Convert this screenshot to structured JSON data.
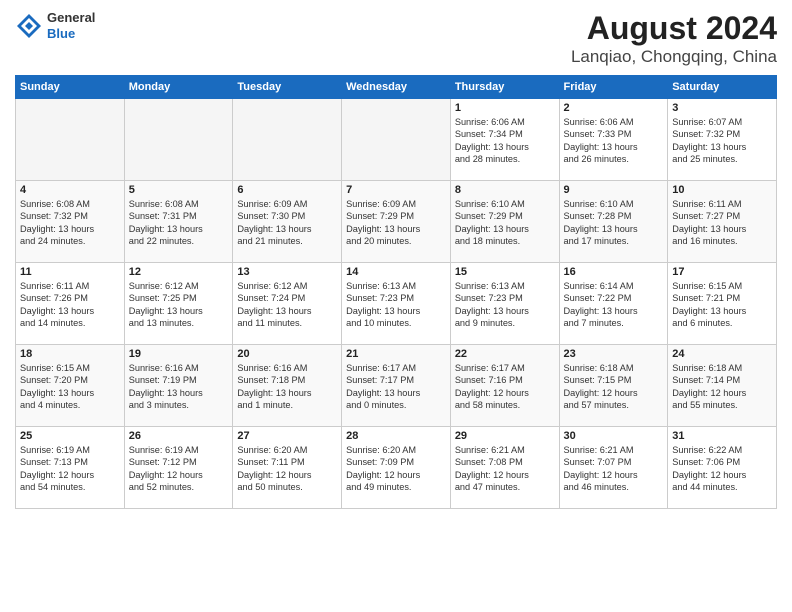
{
  "header": {
    "logo_general": "General",
    "logo_blue": "Blue",
    "title": "August 2024",
    "subtitle": "Lanqiao, Chongqing, China"
  },
  "weekdays": [
    "Sunday",
    "Monday",
    "Tuesday",
    "Wednesday",
    "Thursday",
    "Friday",
    "Saturday"
  ],
  "weeks": [
    [
      {
        "day": "",
        "info": ""
      },
      {
        "day": "",
        "info": ""
      },
      {
        "day": "",
        "info": ""
      },
      {
        "day": "",
        "info": ""
      },
      {
        "day": "1",
        "info": "Sunrise: 6:06 AM\nSunset: 7:34 PM\nDaylight: 13 hours\nand 28 minutes."
      },
      {
        "day": "2",
        "info": "Sunrise: 6:06 AM\nSunset: 7:33 PM\nDaylight: 13 hours\nand 26 minutes."
      },
      {
        "day": "3",
        "info": "Sunrise: 6:07 AM\nSunset: 7:32 PM\nDaylight: 13 hours\nand 25 minutes."
      }
    ],
    [
      {
        "day": "4",
        "info": "Sunrise: 6:08 AM\nSunset: 7:32 PM\nDaylight: 13 hours\nand 24 minutes."
      },
      {
        "day": "5",
        "info": "Sunrise: 6:08 AM\nSunset: 7:31 PM\nDaylight: 13 hours\nand 22 minutes."
      },
      {
        "day": "6",
        "info": "Sunrise: 6:09 AM\nSunset: 7:30 PM\nDaylight: 13 hours\nand 21 minutes."
      },
      {
        "day": "7",
        "info": "Sunrise: 6:09 AM\nSunset: 7:29 PM\nDaylight: 13 hours\nand 20 minutes."
      },
      {
        "day": "8",
        "info": "Sunrise: 6:10 AM\nSunset: 7:29 PM\nDaylight: 13 hours\nand 18 minutes."
      },
      {
        "day": "9",
        "info": "Sunrise: 6:10 AM\nSunset: 7:28 PM\nDaylight: 13 hours\nand 17 minutes."
      },
      {
        "day": "10",
        "info": "Sunrise: 6:11 AM\nSunset: 7:27 PM\nDaylight: 13 hours\nand 16 minutes."
      }
    ],
    [
      {
        "day": "11",
        "info": "Sunrise: 6:11 AM\nSunset: 7:26 PM\nDaylight: 13 hours\nand 14 minutes."
      },
      {
        "day": "12",
        "info": "Sunrise: 6:12 AM\nSunset: 7:25 PM\nDaylight: 13 hours\nand 13 minutes."
      },
      {
        "day": "13",
        "info": "Sunrise: 6:12 AM\nSunset: 7:24 PM\nDaylight: 13 hours\nand 11 minutes."
      },
      {
        "day": "14",
        "info": "Sunrise: 6:13 AM\nSunset: 7:23 PM\nDaylight: 13 hours\nand 10 minutes."
      },
      {
        "day": "15",
        "info": "Sunrise: 6:13 AM\nSunset: 7:23 PM\nDaylight: 13 hours\nand 9 minutes."
      },
      {
        "day": "16",
        "info": "Sunrise: 6:14 AM\nSunset: 7:22 PM\nDaylight: 13 hours\nand 7 minutes."
      },
      {
        "day": "17",
        "info": "Sunrise: 6:15 AM\nSunset: 7:21 PM\nDaylight: 13 hours\nand 6 minutes."
      }
    ],
    [
      {
        "day": "18",
        "info": "Sunrise: 6:15 AM\nSunset: 7:20 PM\nDaylight: 13 hours\nand 4 minutes."
      },
      {
        "day": "19",
        "info": "Sunrise: 6:16 AM\nSunset: 7:19 PM\nDaylight: 13 hours\nand 3 minutes."
      },
      {
        "day": "20",
        "info": "Sunrise: 6:16 AM\nSunset: 7:18 PM\nDaylight: 13 hours\nand 1 minute."
      },
      {
        "day": "21",
        "info": "Sunrise: 6:17 AM\nSunset: 7:17 PM\nDaylight: 13 hours\nand 0 minutes."
      },
      {
        "day": "22",
        "info": "Sunrise: 6:17 AM\nSunset: 7:16 PM\nDaylight: 12 hours\nand 58 minutes."
      },
      {
        "day": "23",
        "info": "Sunrise: 6:18 AM\nSunset: 7:15 PM\nDaylight: 12 hours\nand 57 minutes."
      },
      {
        "day": "24",
        "info": "Sunrise: 6:18 AM\nSunset: 7:14 PM\nDaylight: 12 hours\nand 55 minutes."
      }
    ],
    [
      {
        "day": "25",
        "info": "Sunrise: 6:19 AM\nSunset: 7:13 PM\nDaylight: 12 hours\nand 54 minutes."
      },
      {
        "day": "26",
        "info": "Sunrise: 6:19 AM\nSunset: 7:12 PM\nDaylight: 12 hours\nand 52 minutes."
      },
      {
        "day": "27",
        "info": "Sunrise: 6:20 AM\nSunset: 7:11 PM\nDaylight: 12 hours\nand 50 minutes."
      },
      {
        "day": "28",
        "info": "Sunrise: 6:20 AM\nSunset: 7:09 PM\nDaylight: 12 hours\nand 49 minutes."
      },
      {
        "day": "29",
        "info": "Sunrise: 6:21 AM\nSunset: 7:08 PM\nDaylight: 12 hours\nand 47 minutes."
      },
      {
        "day": "30",
        "info": "Sunrise: 6:21 AM\nSunset: 7:07 PM\nDaylight: 12 hours\nand 46 minutes."
      },
      {
        "day": "31",
        "info": "Sunrise: 6:22 AM\nSunset: 7:06 PM\nDaylight: 12 hours\nand 44 minutes."
      }
    ]
  ]
}
